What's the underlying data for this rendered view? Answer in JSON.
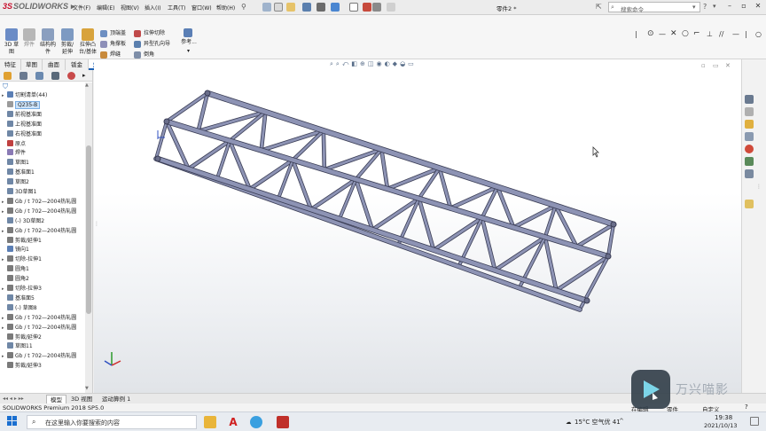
{
  "app": {
    "logo_prefix": "3S",
    "logo": "SOLIDWORKS",
    "doc_title": "零件2 *",
    "search_placeholder": "搜索命令"
  },
  "menu": [
    "文件(F)",
    "编辑(E)",
    "视图(V)",
    "插入(I)",
    "工具(T)",
    "窗口(W)",
    "帮助(H)"
  ],
  "command_manager": {
    "large": [
      {
        "label": "3D 草\n图"
      },
      {
        "label": "焊件"
      },
      {
        "label": "结构构\n件"
      },
      {
        "label": "剪裁/\n延伸"
      },
      {
        "label": "拉伸凸\n台/基体"
      }
    ],
    "col1": [
      "顶端盖",
      "角撑板",
      "焊缝"
    ],
    "col2": [
      "拉伸切除",
      "异型孔向导",
      "倒角"
    ],
    "ref": "参考..."
  },
  "tabs": [
    "特征",
    "草图",
    "曲面",
    "钣金",
    "焊件",
    "评估"
  ],
  "active_tab": "焊件",
  "tree": [
    {
      "label": "切割清单(44)",
      "exp": "▸",
      "color": "#5b7fb5"
    },
    {
      "label": "Q235-B",
      "exp": "",
      "color": "#9b9b9b",
      "selected": true
    },
    {
      "label": "前视基准面",
      "exp": "",
      "color": "#6f87a6"
    },
    {
      "label": "上视基准面",
      "exp": "",
      "color": "#6f87a6"
    },
    {
      "label": "右视基准面",
      "exp": "",
      "color": "#6f87a6"
    },
    {
      "label": "原点",
      "exp": "",
      "color": "#c04040"
    },
    {
      "label": "焊件",
      "exp": "",
      "color": "#8a7ab5"
    },
    {
      "label": "草图1",
      "exp": "",
      "color": "#6f87a6"
    },
    {
      "label": "基准面1",
      "exp": "",
      "color": "#6f87a6"
    },
    {
      "label": "草图2",
      "exp": "",
      "color": "#6f87a6"
    },
    {
      "label": "3D草图1",
      "exp": "",
      "color": "#6f87a6"
    },
    {
      "label": "Gb / t 702—2004热轧圆",
      "exp": "▸",
      "color": "#7a7a7a"
    },
    {
      "label": "Gb / t 702—2004热轧圆",
      "exp": "▸",
      "color": "#7a7a7a"
    },
    {
      "label": "(-) 3D草图2",
      "exp": "",
      "color": "#6f87a6"
    },
    {
      "label": "Gb / t 702—2004热轧圆",
      "exp": "▸",
      "color": "#7a7a7a"
    },
    {
      "label": "剪裁/延伸1",
      "exp": "",
      "color": "#7a7a7a"
    },
    {
      "label": "镜向1",
      "exp": "",
      "color": "#5b7fb5"
    },
    {
      "label": "切除-拉伸1",
      "exp": "▸",
      "color": "#7a7a7a"
    },
    {
      "label": "圆角1",
      "exp": "",
      "color": "#7a7a7a"
    },
    {
      "label": "圆角2",
      "exp": "",
      "color": "#7a7a7a"
    },
    {
      "label": "切除-拉伸3",
      "exp": "▸",
      "color": "#7a7a7a"
    },
    {
      "label": "基准面5",
      "exp": "",
      "color": "#6f87a6"
    },
    {
      "label": "(-) 草图8",
      "exp": "",
      "color": "#6f87a6"
    },
    {
      "label": "Gb / t 702—2004热轧圆",
      "exp": "▸",
      "color": "#7a7a7a"
    },
    {
      "label": "Gb / t 702—2004热轧圆",
      "exp": "▸",
      "color": "#7a7a7a"
    },
    {
      "label": "剪裁/延伸2",
      "exp": "",
      "color": "#7a7a7a"
    },
    {
      "label": "草图11",
      "exp": "",
      "color": "#6f87a6"
    },
    {
      "label": "Gb / t 702—2004热轧圆",
      "exp": "▸",
      "color": "#7a7a7a"
    },
    {
      "label": "剪裁/延伸3",
      "exp": "",
      "color": "#7a7a7a"
    }
  ],
  "bottom_tabs": [
    "模型",
    "3D 视图",
    "运动算例 1"
  ],
  "status": {
    "left": "SOLIDWORKS Premium 2018 SP5.0",
    "mid1": "在编辑",
    "mid2": "零件",
    "right": "自定义"
  },
  "taskbar": {
    "search_placeholder": "在这里输入你要搜索的内容",
    "weather": "15°C 空气优 41",
    "time": "19:38",
    "date": "2021/10/13"
  },
  "watermark": "万兴喵影",
  "colors": {
    "accent": "#1a5fb4",
    "truss": "#8d93b4",
    "truss_dark": "#3a3d55"
  }
}
